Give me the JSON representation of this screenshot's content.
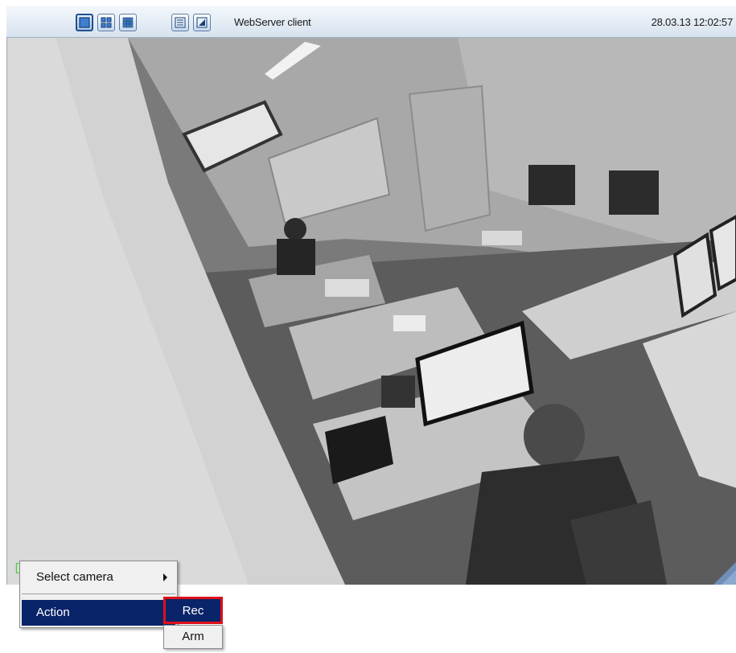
{
  "toolbar": {
    "title": "WebServer client",
    "datetime": "28.03.13 12:02:57",
    "buttons": [
      {
        "icon": "layout-1x1-icon",
        "active": true
      },
      {
        "icon": "layout-2x2-icon",
        "active": false
      },
      {
        "icon": "layout-3x3-icon",
        "active": false
      },
      {
        "icon": "list-icon",
        "active": false
      },
      {
        "icon": "resize-icon",
        "active": false
      }
    ]
  },
  "video": {
    "description_icon": "camera-feed-icon"
  },
  "context_menu": {
    "items": [
      {
        "label": "Select camera",
        "has_submenu": true,
        "selected": false
      },
      {
        "label": "Action",
        "has_submenu": true,
        "selected": true
      }
    ],
    "submenu": [
      {
        "label": "Rec",
        "highlighted": true
      },
      {
        "label": "Arm",
        "highlighted": false
      }
    ]
  },
  "colors": {
    "menu_selection": "#0a246a",
    "highlight_border": "#e0101a",
    "toolbar_bg": "#dbe6f1"
  }
}
